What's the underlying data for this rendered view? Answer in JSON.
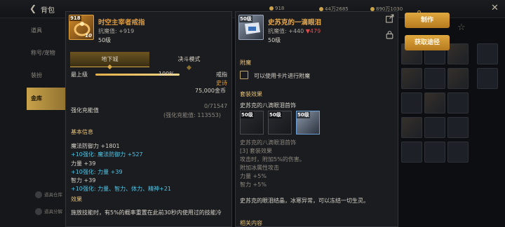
{
  "topbar": {
    "title": "背包",
    "currency_1": "918",
    "currency_2": "44万2685",
    "currency_3": "890万1030"
  },
  "sidebar": {
    "items": [
      {
        "label": "道具"
      },
      {
        "label": "称号/宠物"
      },
      {
        "label": "装扮"
      },
      {
        "label": "金库"
      }
    ],
    "bottom_1": "道具仓库",
    "bottom_2": "道具分解"
  },
  "actions": {
    "make_label": "制作",
    "obtain_label": "获取途径"
  },
  "left_item": {
    "level_tag": "918",
    "icon_level": "10",
    "name": "时空主宰者戒指",
    "magic_resist": "抗魔值: +919",
    "level": "50级",
    "tabs": [
      "地下城",
      "决斗模式"
    ],
    "upgrade_label": "最上级",
    "upgrade_pct": "100%",
    "progress_fraction": 1.0,
    "slot_type": "戒指",
    "rarity": "史诗",
    "price": "75,000金币",
    "enhance_label": "强化充能值",
    "enhance_value": "0/71547",
    "enhance_sub": "(强化充能值: 113553)",
    "basic_title": "基本信息",
    "stats": [
      {
        "text": "魔法防御力 +1801",
        "type": "normal"
      },
      {
        "text": "+10强化: 魔法防御力 +527",
        "type": "cyan"
      },
      {
        "text": "力量 +39",
        "type": "normal"
      },
      {
        "text": "+10强化: 力量 +39",
        "type": "cyan"
      },
      {
        "text": "智力 +39",
        "type": "normal"
      },
      {
        "text": "+10强化: 力量、智力、体力、精神+21",
        "type": "cyan"
      }
    ],
    "effect_title": "效果",
    "effect_text": "施放技能时，有5%的概率重置在此前30秒内使用过的技能冷"
  },
  "right_item": {
    "level_tag": "50级",
    "name": "史苏克的一滴眼泪",
    "magic_resist": "抗魔值: +440",
    "resist_diff": "▼479",
    "level": "50级",
    "enchant_title": "附魔",
    "enchant_text": "可以使用卡片进行附魔",
    "set_title": "套装效果",
    "set_name": "史苏克的八滴眼泪首饰",
    "set_icons": [
      {
        "tag": "50级",
        "owned": false
      },
      {
        "tag": "50级",
        "owned": false
      },
      {
        "tag": "50级",
        "owned": true
      }
    ],
    "set_lines": [
      "史苏克的八滴眼泪首饰",
      "[3] 套装效果",
      "攻击时，附加5%的伤害。",
      "附加冰属性攻击",
      "力量 +5%",
      "智力 +5%"
    ],
    "flavor": "史苏克的眼泪结晶，冰寒异常，可以冻结一切生灵。",
    "next_title": "相关内容"
  },
  "colors": {
    "accent_gold": "#d9aa48",
    "epic_orange": "#e09a3a",
    "enhance_cyan": "#4fc6e6",
    "down_red": "#e34b4b"
  }
}
